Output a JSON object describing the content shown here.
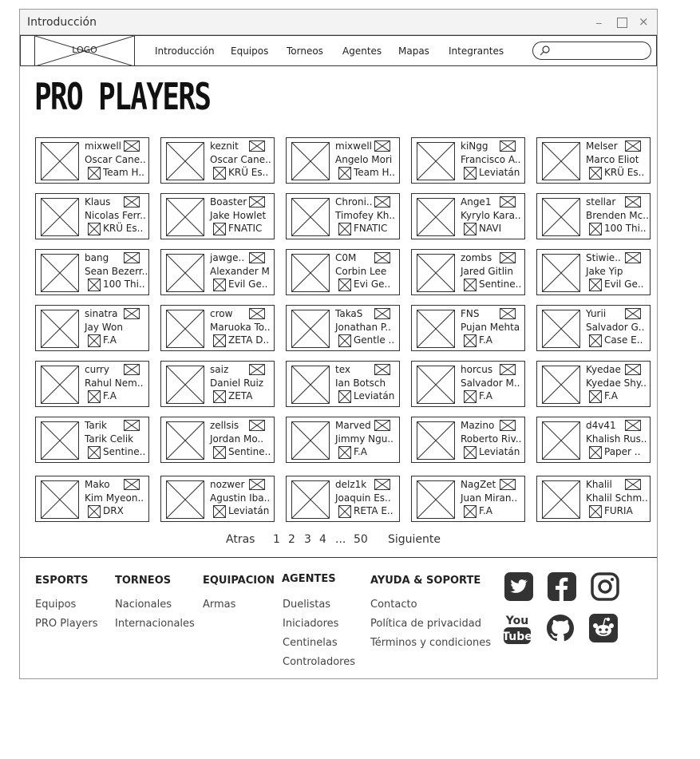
{
  "window": {
    "title": "Introducción"
  },
  "nav": {
    "logo": "LOGO",
    "items": [
      "Introducción",
      "Equipos",
      "Torneos",
      "Agentes",
      "Mapas",
      "Integrantes"
    ],
    "search_placeholder": ""
  },
  "page": {
    "title": "PRO PLAYERS"
  },
  "players": [
    {
      "nick": "mixwell",
      "name": "Oscar Cane..",
      "team": "Team H.."
    },
    {
      "nick": "keznit",
      "name": "Oscar Cane..",
      "team": "KRÜ Es.."
    },
    {
      "nick": "mixwell",
      "name": "Angelo Mori",
      "team": "Team H.."
    },
    {
      "nick": "kiNgg",
      "name": "Francisco A..",
      "team": "Leviatán"
    },
    {
      "nick": "Melser",
      "name": "Marco Eliot",
      "team": "KRÜ Es.."
    },
    {
      "nick": "Klaus",
      "name": "Nicolas Ferr..",
      "team": "KRÜ Es.."
    },
    {
      "nick": "Boaster",
      "name": "Jake Howlet",
      "team": "FNATIC"
    },
    {
      "nick": "Chroni..",
      "name": "Timofey Kh..",
      "team": "FNATIC"
    },
    {
      "nick": "Ange1",
      "name": "Kyrylo Kara..",
      "team": "NAVI"
    },
    {
      "nick": "stellar",
      "name": "Brenden Mc..",
      "team": "100 Thi.."
    },
    {
      "nick": "bang",
      "name": "Sean Bezerr..",
      "team": "100 Thi.."
    },
    {
      "nick": "jawge..",
      "name": "Alexander M",
      "team": "Evil Ge.."
    },
    {
      "nick": "C0M",
      "name": "Corbin Lee",
      "team": "Evi Ge.."
    },
    {
      "nick": "zombs",
      "name": "Jared Gitlin",
      "team": "Sentine.."
    },
    {
      "nick": "Stiwie..",
      "name": "Jake Yip",
      "team": "Evil Ge.."
    },
    {
      "nick": "sinatra",
      "name": "Jay Won",
      "team": "F.A"
    },
    {
      "nick": "crow",
      "name": "Maruoka To..",
      "team": "ZETA D.."
    },
    {
      "nick": "TakaS",
      "name": "Jonathan P..",
      "team": "Gentle .."
    },
    {
      "nick": "FNS",
      "name": "Pujan Mehta",
      "team": "F.A"
    },
    {
      "nick": "Yurii",
      "name": "Salvador G..",
      "team": "Case E.."
    },
    {
      "nick": "curry",
      "name": "Rahul Nem..",
      "team": "F.A"
    },
    {
      "nick": "saiz",
      "name": "Daniel Ruiz",
      "team": "ZETA"
    },
    {
      "nick": "tex",
      "name": "Ian Botsch",
      "team": "Leviatán"
    },
    {
      "nick": "horcus",
      "name": "Salvador M..",
      "team": "F.A"
    },
    {
      "nick": "Kyedae",
      "name": "Kyedae Shy..",
      "team": "F.A"
    },
    {
      "nick": "Tarik",
      "name": "Tarik Celik",
      "team": "Sentine.."
    },
    {
      "nick": "zellsis",
      "name": "Jordan Mo..",
      "team": "Sentine.."
    },
    {
      "nick": "Marved",
      "name": "Jimmy Ngu..",
      "team": "F.A"
    },
    {
      "nick": "Mazino",
      "name": "Roberto Riv..",
      "team": "Leviatán"
    },
    {
      "nick": "d4v41",
      "name": "Khalish Rus..",
      "team": "Paper .."
    },
    {
      "nick": "Mako",
      "name": "Kim Myeon..",
      "team": "DRX"
    },
    {
      "nick": "nozwer",
      "name": "Agustin Iba..",
      "team": "Leviatán"
    },
    {
      "nick": "delz1k",
      "name": "Joaquin Es..",
      "team": "RETA E.."
    },
    {
      "nick": "NagZet",
      "name": "Juan Miran..",
      "team": "F.A"
    },
    {
      "nick": "Khalil",
      "name": "Khalil Schm..",
      "team": "FURIA"
    }
  ],
  "pagination": {
    "prev": "Atras",
    "pages": [
      "1",
      "2",
      "3",
      "4",
      "...",
      "50"
    ],
    "next": "Siguiente"
  },
  "footer": {
    "esports": {
      "title": "ESPORTS",
      "links": [
        "Equipos",
        "PRO Players"
      ]
    },
    "torneos": {
      "title": "TORNEOS",
      "links": [
        "Nacionales",
        "Internacionales"
      ]
    },
    "equipacion": {
      "title": "EQUIPACION",
      "links": [
        "Armas"
      ]
    },
    "agentes": {
      "title": "AGENTES",
      "links": [
        "Duelistas",
        "Iniciadores",
        "Centinelas",
        "Controladores"
      ]
    },
    "ayuda": {
      "title": "AYUDA & SOPORTE",
      "links": [
        "Contacto",
        "Política de privacidad",
        "Términos y condiciones"
      ]
    },
    "social": [
      "twitter-icon",
      "facebook-icon",
      "instagram-icon",
      "youtube-icon",
      "github-icon",
      "reddit-icon"
    ],
    "social_color": "#333333"
  }
}
